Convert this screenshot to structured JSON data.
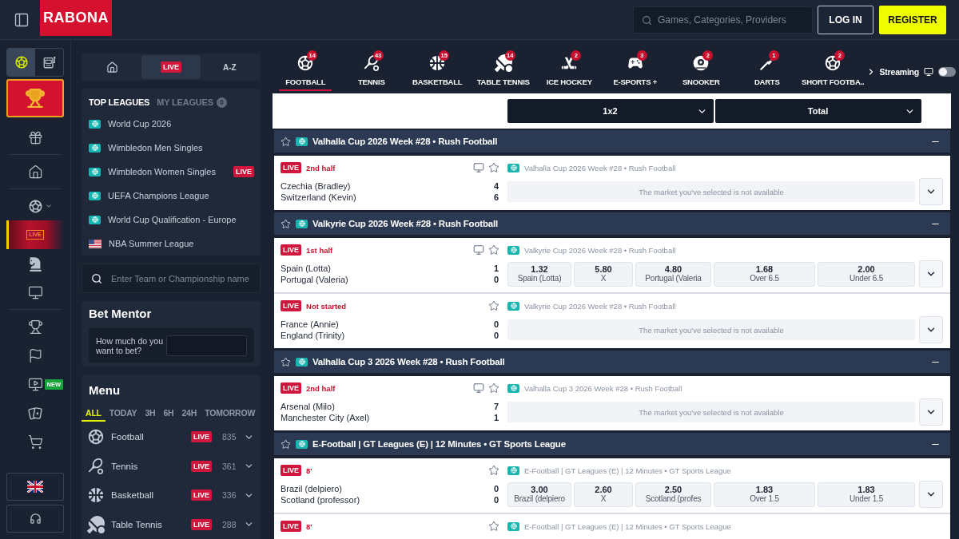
{
  "header": {
    "logo": "RABONA",
    "search": {
      "placeholder": "Games, Categories, Providers"
    },
    "buttons": [
      {
        "label": "LOG IN",
        "kind": "outline"
      },
      {
        "label": "REGISTER",
        "kind": "primary"
      }
    ]
  },
  "rail": {
    "modes": [
      {
        "selected": true
      },
      {
        "selected": false
      }
    ],
    "groups": [
      [
        {
          "selected": false,
          "expandable": false
        }
      ],
      [
        {
          "selected": false,
          "expandable": false
        }
      ],
      [
        {
          "selected": false,
          "expandable": true
        },
        {
          "selected": true,
          "expandable": false,
          "label": "LIVE"
        },
        {
          "selected": false,
          "expandable": false
        },
        {
          "selected": false,
          "expandable": false
        }
      ],
      [
        {
          "selected": false,
          "expandable": false
        },
        {
          "selected": false,
          "expandable": false
        },
        {
          "selected": false,
          "expandable": false,
          "tag": "NEW"
        },
        {
          "selected": false,
          "expandable": false
        },
        {
          "selected": false,
          "expandable": false
        }
      ]
    ]
  },
  "quick_tabs": [
    {
      "kind": "icon",
      "selected": false
    },
    {
      "kind": "badge",
      "label": "LIVE",
      "selected": true
    },
    {
      "kind": "text",
      "label": "A-Z",
      "selected": false
    }
  ],
  "leagues": {
    "tabs": [
      {
        "label": "TOP LEAGUES",
        "selected": true
      },
      {
        "label": "MY LEAGUES",
        "selected": false,
        "count": "0"
      }
    ],
    "items": [
      {
        "name": "World Cup 2026",
        "kind": "region"
      },
      {
        "name": "Wimbledon Men Singles",
        "kind": "region"
      },
      {
        "name": "Wimbledon Women Singles",
        "kind": "region",
        "badge": "LIVE"
      },
      {
        "name": "UEFA Champions League",
        "kind": "region"
      },
      {
        "name": "World Cup Qualification - Europe",
        "kind": "region"
      },
      {
        "name": "NBA Summer League",
        "kind": "country"
      }
    ]
  },
  "team_search": {
    "placeholder": "Enter Team or Championship name"
  },
  "bet_mentor": {
    "title": "Bet Mentor",
    "prompt": "How much do you want to bet?"
  },
  "menu": {
    "title": "Menu",
    "filters": [
      {
        "label": "ALL",
        "selected": true
      },
      {
        "label": "TODAY",
        "selected": false
      },
      {
        "label": "3H",
        "selected": false
      },
      {
        "label": "6H",
        "selected": false
      },
      {
        "label": "24H",
        "selected": false
      },
      {
        "label": "TOMORROW",
        "selected": false
      }
    ],
    "sports": [
      {
        "name": "Football",
        "badge": "LIVE",
        "count": "835",
        "expanded": false
      },
      {
        "name": "Tennis",
        "badge": "LIVE",
        "count": "361",
        "expanded": false
      },
      {
        "name": "Basketball",
        "badge": "LIVE",
        "count": "336",
        "expanded": false
      },
      {
        "name": "Table Tennis",
        "badge": "LIVE",
        "count": "288",
        "expanded": false
      }
    ]
  },
  "sport_tabs": {
    "items": [
      {
        "label": "FOOTBALL",
        "count": "14",
        "selected": true
      },
      {
        "label": "TENNIS",
        "count": "43",
        "selected": false
      },
      {
        "label": "BASKETBALL",
        "count": "15",
        "selected": false
      },
      {
        "label": "TABLE TENNIS",
        "count": "14",
        "selected": false
      },
      {
        "label": "ICE HOCKEY",
        "count": "2",
        "selected": false
      },
      {
        "label": "E-SPORTS +",
        "count": "3",
        "selected": false
      },
      {
        "label": "SNOOKER",
        "count": "2",
        "selected": false
      },
      {
        "label": "DARTS",
        "count": "1",
        "selected": false
      },
      {
        "label": "SHORT FOOTBA..",
        "count": "2",
        "selected": false
      }
    ],
    "streaming": {
      "label": "Streaming",
      "on": false
    }
  },
  "market_selectors": [
    {
      "label": "1x2"
    },
    {
      "label": "Total"
    }
  ],
  "sections": [
    {
      "title": "Valhalla Cup 2026 Week #28 • Rush Football",
      "expanded": true,
      "matches": [
        {
          "badge": "LIVE",
          "status": "2nd half",
          "stream": true,
          "league": "Valhalla Cup 2026 Week #28 • Rush Football",
          "teams": [
            {
              "name": "Czechia (Bradley)",
              "score": "4"
            },
            {
              "name": "Switzerland (Kevin)",
              "score": "6"
            }
          ],
          "market": {
            "kind": "unavailable",
            "message": "The market you've selected is not available"
          }
        }
      ]
    },
    {
      "title": "Valkyrie Cup 2026 Week #28 • Rush Football",
      "expanded": true,
      "matches": [
        {
          "badge": "LIVE",
          "status": "1st half",
          "stream": true,
          "league": "Valkyrie Cup 2026 Week #28 • Rush Football",
          "teams": [
            {
              "name": "Spain (Lotta)",
              "score": "1"
            },
            {
              "name": "Portugal (Valeria)",
              "score": "0"
            }
          ],
          "market": {
            "kind": "odds",
            "odds": [
              {
                "value": "1.32",
                "label": "Spain (Lotta)"
              },
              {
                "value": "5.80",
                "label": "X"
              },
              {
                "value": "4.80",
                "label": "Portugal (Valeria"
              },
              {
                "value": "1.68",
                "label": "Over 6.5"
              },
              {
                "value": "2.00",
                "label": "Under 6.5"
              }
            ]
          }
        },
        {
          "badge": "LIVE",
          "status": "Not started",
          "stream": false,
          "league": "Valkyrie Cup 2026 Week #28 • Rush Football",
          "teams": [
            {
              "name": "France (Annie)",
              "score": "0"
            },
            {
              "name": "England (Trinity)",
              "score": "0"
            }
          ],
          "market": {
            "kind": "unavailable",
            "message": "The market you've selected is not available"
          }
        }
      ]
    },
    {
      "title": "Valhalla Cup 3 2026 Week #28 • Rush Football",
      "expanded": true,
      "matches": [
        {
          "badge": "LIVE",
          "status": "2nd half",
          "stream": true,
          "league": "Valhalla Cup 3 2026 Week #28 • Rush Football",
          "teams": [
            {
              "name": "Arsenal (Milo)",
              "score": "7"
            },
            {
              "name": "Manchester City (Axel)",
              "score": "1"
            }
          ],
          "market": {
            "kind": "unavailable",
            "message": "The market you've selected is not available"
          }
        }
      ]
    },
    {
      "title": "E-Football | GT Leagues (E) | 12 Minutes • GT Sports League",
      "expanded": true,
      "matches": [
        {
          "badge": "LIVE",
          "status": "8'",
          "stream": false,
          "league": "E-Football | GT Leagues (E) | 12 Minutes • GT Sports League",
          "teams": [
            {
              "name": "Brazil (delpiero)",
              "score": "0"
            },
            {
              "name": "Scotland (professor)",
              "score": "0"
            }
          ],
          "market": {
            "kind": "odds",
            "odds": [
              {
                "value": "3.00",
                "label": "Brazil (delpiero"
              },
              {
                "value": "2.60",
                "label": "X"
              },
              {
                "value": "2.50",
                "label": "Scotland (profes"
              },
              {
                "value": "1.83",
                "label": "Over 1.5"
              },
              {
                "value": "1.83",
                "label": "Under 1.5"
              }
            ]
          }
        },
        {
          "badge": "LIVE",
          "status": "8'",
          "stream": false,
          "league": "E-Football | GT Leagues (E) | 12 Minutes • GT Sports League"
        }
      ]
    }
  ]
}
